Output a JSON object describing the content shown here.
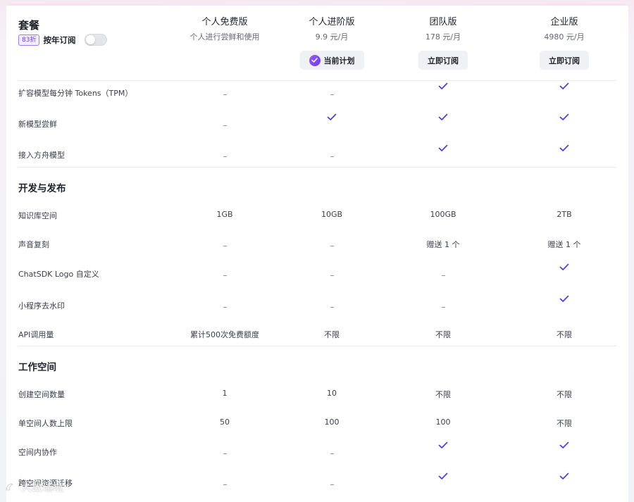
{
  "header": {
    "title": "套餐",
    "discount_badge": "83折",
    "yearly_label": "按年订阅",
    "yearly_enabled": false
  },
  "plans": [
    {
      "name": "个人免费版",
      "price": "个人进行尝鲜和使用",
      "button": null,
      "current": false
    },
    {
      "name": "个人进阶版",
      "price": "9.9 元/月",
      "button": "当前计划",
      "current": true
    },
    {
      "name": "团队版",
      "price": "178 元/月",
      "button": "立即订阅",
      "current": false
    },
    {
      "name": "企业版",
      "price": "4980 元/月",
      "button": "立即订阅",
      "current": false
    }
  ],
  "sections": [
    {
      "title": "",
      "rows": [
        {
          "label": "扩容模型每分钟 Tokens（TPM）",
          "values": [
            "-",
            "-",
            "check",
            "check"
          ]
        },
        {
          "label": "新模型尝鲜",
          "values": [
            "-",
            "check",
            "check",
            "check"
          ]
        },
        {
          "label": "接入方舟模型",
          "values": [
            "-",
            "-",
            "check",
            "check"
          ]
        }
      ]
    },
    {
      "title": "开发与发布",
      "rows": [
        {
          "label": "知识库空间",
          "values": [
            "1GB",
            "10GB",
            "100GB",
            "2TB"
          ]
        },
        {
          "label": "声音复刻",
          "values": [
            "-",
            "-",
            "赠送 1 个",
            "赠送 1 个"
          ]
        },
        {
          "label": "ChatSDK Logo 自定义",
          "values": [
            "-",
            "-",
            "-",
            "check"
          ]
        },
        {
          "label": "小程序去水印",
          "values": [
            "-",
            "-",
            "-",
            "check"
          ]
        },
        {
          "label": "API调用量",
          "values": [
            "累计500次免费额度",
            "不限",
            "不限",
            "不限"
          ]
        }
      ]
    },
    {
      "title": "工作空间",
      "rows": [
        {
          "label": "创建空间数量",
          "values": [
            "1",
            "10",
            "不限",
            "不限"
          ]
        },
        {
          "label": "单空间人数上限",
          "values": [
            "50",
            "100",
            "100",
            "不限"
          ]
        },
        {
          "label": "空间内协作",
          "values": [
            "-",
            "-",
            "check",
            "check"
          ]
        },
        {
          "label": "跨空间资源迁移",
          "values": [
            "-",
            "-",
            "check",
            "check"
          ]
        }
      ]
    }
  ],
  "watermark": "大故瑞境",
  "colors": {
    "accent": "#6a3de8",
    "check": "#4b3fd6",
    "dash": "#8f959e"
  },
  "icons": {
    "check": "check-icon",
    "current": "check-circle-icon"
  }
}
